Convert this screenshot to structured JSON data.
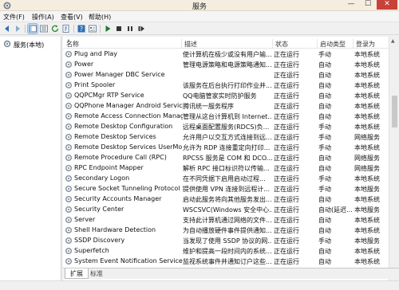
{
  "window": {
    "title": "服务",
    "min_glyph": "—",
    "max_glyph": "☐",
    "close_glyph": "✕"
  },
  "menu": [
    "文件(F)",
    "操作(A)",
    "查看(V)",
    "帮助(H)"
  ],
  "toolbar_icons": [
    "back-icon",
    "forward-icon",
    "console-tree-icon",
    "list-view-icon",
    "refresh-icon",
    "export-icon",
    "help-icon",
    "properties-icon",
    "start-icon",
    "stop-icon",
    "pause-icon",
    "restart-icon"
  ],
  "tree": {
    "root_label": "服务(本地)"
  },
  "columns": {
    "name": "名称",
    "desc": "描述",
    "status": "状态",
    "startup": "启动类型",
    "logon": "登录为"
  },
  "services": [
    {
      "name": "Plug and Play",
      "desc": "使计算机在极少或没有用户输...",
      "status": "正在运行",
      "startup": "手动",
      "logon": "本地系统"
    },
    {
      "name": "Power",
      "desc": "管理电源策略和电源策略通知...",
      "status": "正在运行",
      "startup": "自动",
      "logon": "本地系统"
    },
    {
      "name": "Power Manager DBC Service",
      "desc": "",
      "status": "正在运行",
      "startup": "自动",
      "logon": "本地系统"
    },
    {
      "name": "Print Spooler",
      "desc": "该服务在后台执行打印作业并...",
      "status": "正在运行",
      "startup": "自动",
      "logon": "本地系统"
    },
    {
      "name": "QQPCMgr RTP Service",
      "desc": "QQ电脑管家实时防护服务",
      "status": "正在运行",
      "startup": "自动",
      "logon": "本地系统"
    },
    {
      "name": "QQPhone Manager Android Service",
      "desc": "腾讯统一服务程序",
      "status": "正在运行",
      "startup": "自动",
      "logon": "本地系统"
    },
    {
      "name": "Remote Access Connection Manager",
      "desc": "管理从这台计算机到 Internet...",
      "status": "正在运行",
      "startup": "自动",
      "logon": "本地系统"
    },
    {
      "name": "Remote Desktop Configuration",
      "desc": "远程桌面配置服务(RDCS)负...",
      "status": "正在运行",
      "startup": "手动",
      "logon": "本地系统"
    },
    {
      "name": "Remote Desktop Services",
      "desc": "允许用户以交互方式连接到远...",
      "status": "正在运行",
      "startup": "手动",
      "logon": "网络服务"
    },
    {
      "name": "Remote Desktop Services UserMo...",
      "desc": "允许为 RDP 连接重定向打印...",
      "status": "正在运行",
      "startup": "手动",
      "logon": "本地系统"
    },
    {
      "name": "Remote Procedure Call (RPC)",
      "desc": "RPCSS 服务是 COM 和 DCO...",
      "status": "正在运行",
      "startup": "自动",
      "logon": "网络服务"
    },
    {
      "name": "RPC Endpoint Mapper",
      "desc": "解析 RPC 接口标识符以传输...",
      "status": "正在运行",
      "startup": "自动",
      "logon": "网络服务"
    },
    {
      "name": "Secondary Logon",
      "desc": "在不同凭据下启用启动过程...",
      "status": "正在运行",
      "startup": "手动",
      "logon": "本地系统"
    },
    {
      "name": "Secure Socket Tunneling Protocol S...",
      "desc": "提供使用 VPN 连接到远程计...",
      "status": "正在运行",
      "startup": "手动",
      "logon": "本地服务"
    },
    {
      "name": "Security Accounts Manager",
      "desc": "启动此服务将向其他服务发出...",
      "status": "正在运行",
      "startup": "自动",
      "logon": "本地系统"
    },
    {
      "name": "Security Center",
      "desc": "WSCSVC(Windows 安全中心...",
      "status": "正在运行",
      "startup": "自动(延迟...",
      "logon": "本地服务"
    },
    {
      "name": "Server",
      "desc": "支持此计算机通过网络的文件...",
      "status": "正在运行",
      "startup": "自动",
      "logon": "本地系统"
    },
    {
      "name": "Shell Hardware Detection",
      "desc": "为自动播放硬件事件提供通知...",
      "status": "正在运行",
      "startup": "自动",
      "logon": "本地系统"
    },
    {
      "name": "SSDP Discovery",
      "desc": "当发现了使用 SSDP 协议的网...",
      "status": "正在运行",
      "startup": "手动",
      "logon": "本地服务"
    },
    {
      "name": "Superfetch",
      "desc": "维护和提高一段时间内的系统...",
      "status": "正在运行",
      "startup": "自动",
      "logon": "本地系统"
    },
    {
      "name": "System Event Notification Service",
      "desc": "监视系统事件并通知订户这些...",
      "status": "正在运行",
      "startup": "自动",
      "logon": "本地系统"
    }
  ],
  "tabs": {
    "extended": "扩展",
    "standard": "标准"
  }
}
